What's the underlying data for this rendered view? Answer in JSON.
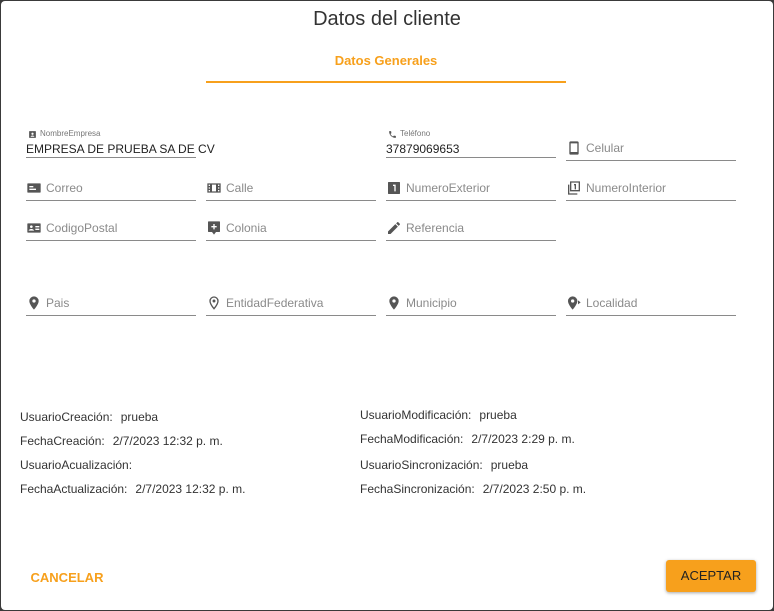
{
  "dialog": {
    "title": "Datos del cliente"
  },
  "tabs": {
    "general": "Datos Generales"
  },
  "fields": {
    "nombre_empresa": {
      "label": "NombreEmpresa",
      "value": "EMPRESA DE PRUEBA SA DE CV",
      "icon": "contact-icon"
    },
    "telefono": {
      "label": "Teléfono",
      "value": "37879069653",
      "icon": "phone-icon"
    },
    "celular": {
      "placeholder": "Celular",
      "icon": "cellphone-icon"
    },
    "correo": {
      "placeholder": "Correo",
      "icon": "mail-card-icon"
    },
    "calle": {
      "placeholder": "Calle",
      "icon": "road-icon"
    },
    "numero_exterior": {
      "placeholder": "NumeroExterior",
      "icon": "numeric-1-box-icon"
    },
    "numero_interior": {
      "placeholder": "NumeroInterior",
      "icon": "numeric-1-multiple-icon"
    },
    "codigo_postal": {
      "placeholder": "CodigoPostal",
      "icon": "card-account-icon"
    },
    "colonia": {
      "placeholder": "Colonia",
      "icon": "map-marker-plus-icon"
    },
    "referencia": {
      "placeholder": "Referencia",
      "icon": "pencil-icon"
    },
    "pais": {
      "placeholder": "Pais",
      "icon": "map-marker-icon"
    },
    "entidad_federativa": {
      "placeholder": "EntidadFederativa",
      "icon": "map-marker-outline-icon"
    },
    "municipio": {
      "placeholder": "Municipio",
      "icon": "map-marker-icon"
    },
    "localidad": {
      "placeholder": "Localidad",
      "icon": "map-marker-right-icon"
    }
  },
  "audit": {
    "usuario_creacion": {
      "label": "UsuarioCreación:",
      "value": "prueba"
    },
    "fecha_creacion": {
      "label": "FechaCreación:",
      "value": "2/7/2023 12:32 p. m."
    },
    "usuario_actualizacion": {
      "label": "UsuarioAcualización:",
      "value": ""
    },
    "fecha_actualizacion": {
      "label": "FechaActualización:",
      "value": "2/7/2023 12:32 p. m."
    },
    "usuario_modificacion": {
      "label": "UsuarioModificación:",
      "value": "prueba"
    },
    "fecha_modificacion": {
      "label": "FechaModificación:",
      "value": "2/7/2023 2:29 p. m."
    },
    "usuario_sincronizacion": {
      "label": "UsuarioSincronización:",
      "value": "prueba"
    },
    "fecha_sincronizacion": {
      "label": "FechaSincronización:",
      "value": "2/7/2023 2:50 p. m."
    }
  },
  "actions": {
    "cancel": "CANCELAR",
    "accept": "ACEPTAR"
  },
  "colors": {
    "accent": "#f7a01c",
    "underline": "#8a8a8a"
  }
}
